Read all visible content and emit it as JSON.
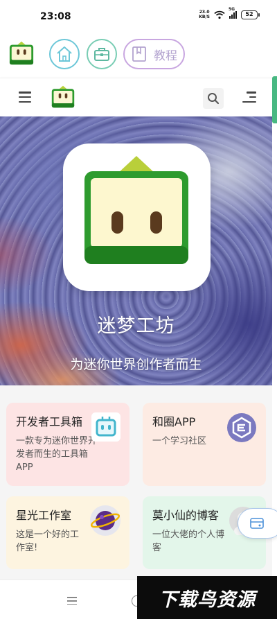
{
  "status_bar": {
    "time": "23:08",
    "net_speed_value": "23.0",
    "net_speed_unit": "KB/S",
    "signal_label": "5G",
    "battery": "52"
  },
  "app_bar": {
    "tutorial_label": "教程"
  },
  "hero": {
    "title": "迷梦工坊",
    "subtitle": "为迷你世界创作者而生"
  },
  "cards": [
    {
      "title": "开发者工具箱",
      "desc": "一款专为迷你世界开发者而生的工具箱APP",
      "icon": "robot-box-icon"
    },
    {
      "title": "和圈APP",
      "desc": "一个学习社区",
      "icon": "hexagon-e-icon"
    },
    {
      "title": "星光工作室",
      "desc": "这是一个好的工作室!",
      "icon": "planet-icon"
    },
    {
      "title": "莫小仙的博客",
      "desc": "一位大佬的个人博客",
      "icon": "avatar-icon"
    }
  ],
  "watermark": {
    "text": "下载鸟资源"
  },
  "colors": {
    "brand_green": "#2e9b2e",
    "accent_teal": "#48b882"
  }
}
